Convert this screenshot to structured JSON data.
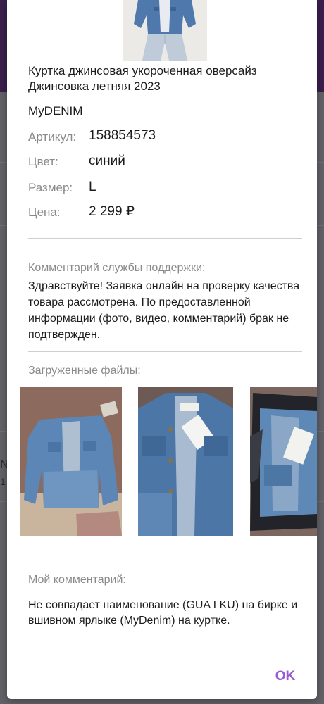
{
  "product": {
    "title": "Куртка джинсовая укороченная оверсайз Джинсовка летняя 2023",
    "brand": "MyDENIM",
    "article_label": "Артикул:",
    "article_value": "158854573",
    "color_label": "Цвет:",
    "color_value": "синий",
    "size_label": "Размер:",
    "size_value": "L",
    "price_label": "Цена:",
    "price_value": "2 299 ₽"
  },
  "support": {
    "label": "Комментарий службы поддержки:",
    "text": "Здравствуйте! Заявка онлайн на проверку качества товара рассмотрена. По предоставленной информации (фото, видео, комментарий) брак не подтвержден."
  },
  "files": {
    "label": "Загруженные файлы:"
  },
  "my_comment": {
    "label": "Мой комментарий:",
    "text": "Не совпадает наименование (GUA I KU) на бирке и вшивном ярлыке (MyDenim) на куртке."
  },
  "actions": {
    "ok_label": "OK"
  },
  "background": {
    "peek_1": "N",
    "peek_2": "1"
  },
  "colors": {
    "accent": "#9a58d6",
    "muted_text": "#8a8a8e",
    "header_dim": "#3a1e4d",
    "overlay_dim": "#616166"
  }
}
